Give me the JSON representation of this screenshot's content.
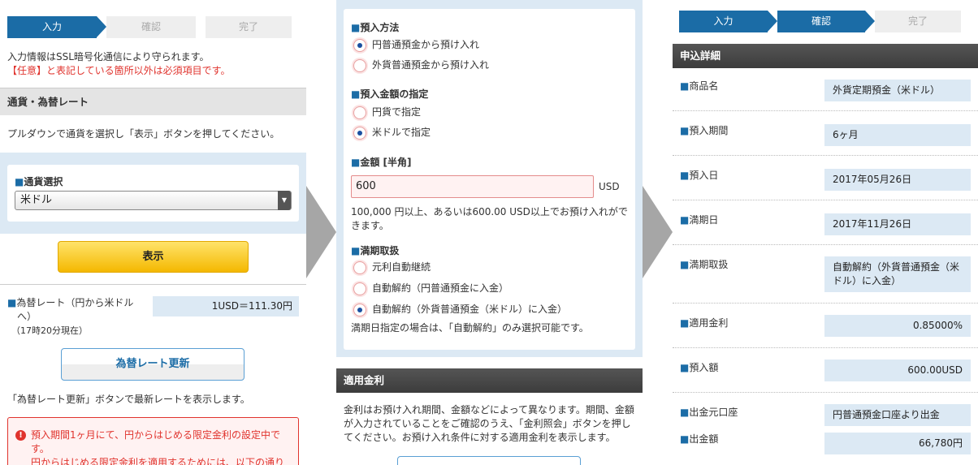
{
  "panel1": {
    "steps": [
      "入力",
      "確認",
      "完了"
    ],
    "ssl_note": "入力情報はSSL暗号化通信により守られます。",
    "required_note": "【任意】と表記している箇所以外は必須項目です。",
    "section_title": "通貨・為替レート",
    "instruction": "プルダウンで通貨を選択し「表示」ボタンを押してください。",
    "currency_label": "通貨選択",
    "currency_value": "米ドル",
    "show_button": "表示",
    "rate_label_1": "為替レート（円から米ドル",
    "rate_label_2": "へ）",
    "rate_time": "（17時20分現在）",
    "rate_value": "1USD＝111.30円",
    "refresh_button": "為替レート更新",
    "refresh_note": "「為替レート更新」ボタンで最新レートを表示します。",
    "warning_line1": "預入期間1ヶ月にて、円からはじめる限定金利の設定中で",
    "warning_line2": "す。",
    "warning_line3": "円からはじめる限定金利を適用するためには、以下の通り"
  },
  "panel2": {
    "deposit_method_label": "預入方法",
    "deposit_method_options": [
      "円普通預金から預け入れ",
      "外貨普通預金から預け入れ"
    ],
    "amount_spec_label": "預入金額の指定",
    "amount_spec_options": [
      "円貨で指定",
      "米ドルで指定"
    ],
    "amount_label": "金額 [半角]",
    "amount_value": "600",
    "amount_unit": "USD",
    "amount_note_1": "100,000 円以上、あるいは600.00 USD以上でお預け入れがで",
    "amount_note_2": "きます。",
    "maturity_label": "満期取扱",
    "maturity_options": [
      "元利自動継続",
      "自動解約（円普通預金に入金）",
      "自動解約（外貨普通預金（米ドル）に入金）"
    ],
    "maturity_note": "満期日指定の場合は、「自動解約」のみ選択可能です。",
    "rate_section_title": "適用金利",
    "rate_note_1": "金利はお預け入れ期間、金額などによって異なります。期間、金額",
    "rate_note_2": "が入力されていることをご確認のうえ、「金利照会」ボタンを押し",
    "rate_note_3": "てください。お預け入れ条件に対する適用金利を表示します。"
  },
  "panel3": {
    "steps": [
      "入力",
      "確認",
      "完了"
    ],
    "section_title": "申込詳細",
    "rows": [
      {
        "label": "商品名",
        "value": "外貨定期預金（米ドル）"
      },
      {
        "label": "預入期間",
        "value": "6ヶ月"
      },
      {
        "label": "預入日",
        "value": "2017年05月26日"
      },
      {
        "label": "満期日",
        "value": "2017年11月26日"
      },
      {
        "label": "満期取扱",
        "value_1": "自動解約（外貨普通預金（米",
        "value_2": "ドル）に入金）"
      },
      {
        "label": "適用金利",
        "value": "0.85000%"
      },
      {
        "label": "預入額",
        "value": "600.00USD"
      },
      {
        "label": "出金元口座",
        "value": "円普通預金口座より出金"
      },
      {
        "label": "出金額",
        "value": "66,780円"
      }
    ]
  },
  "square_mark": "■",
  "colors": {
    "accent": "#1b6ca6",
    "error": "#e0332d",
    "field_bg": "#dce9f4"
  }
}
